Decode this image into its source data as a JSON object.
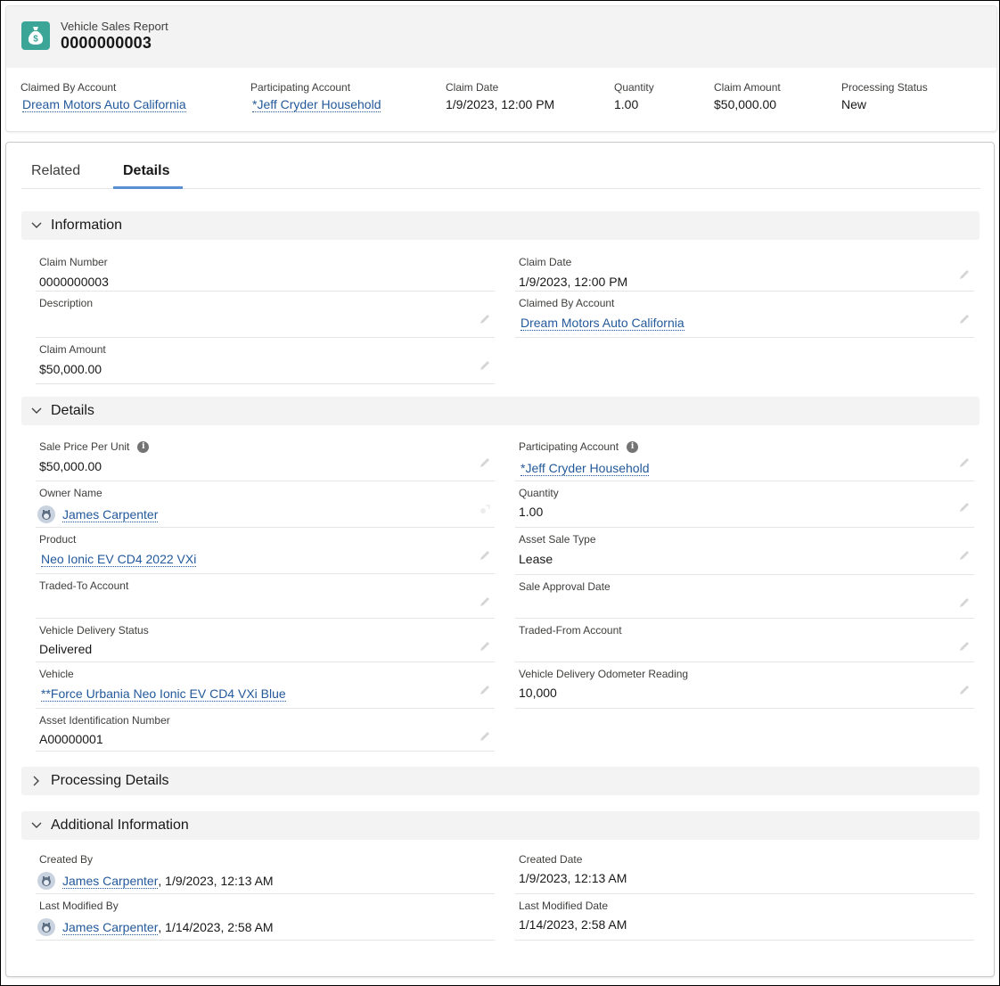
{
  "header": {
    "object_type": "Vehicle Sales Report",
    "record_title": "0000000003",
    "icon": "money-bag-icon",
    "icon_color": "#3ba597"
  },
  "highlights": [
    {
      "label": "Claimed By Account",
      "value": "Dream Motors Auto California",
      "link": true
    },
    {
      "label": "Participating Account",
      "value": "*Jeff Cryder Household",
      "link": true
    },
    {
      "label": "Claim Date",
      "value": "1/9/2023, 12:00 PM",
      "link": false
    },
    {
      "label": "Quantity",
      "value": "1.00",
      "link": false
    },
    {
      "label": "Claim Amount",
      "value": "$50,000.00",
      "link": false
    },
    {
      "label": "Processing Status",
      "value": "New",
      "link": false
    }
  ],
  "tabs": [
    {
      "label": "Related",
      "active": false
    },
    {
      "label": "Details",
      "active": true
    }
  ],
  "sections": {
    "information": {
      "title": "Information",
      "expanded": true,
      "left": [
        {
          "label": "Claim Number",
          "value": "0000000003",
          "editable": false
        },
        {
          "label": "Description",
          "value": "",
          "editable": true
        },
        {
          "label": "Claim Amount",
          "value": "$50,000.00",
          "editable": true
        }
      ],
      "right": [
        {
          "label": "Claim Date",
          "value": "1/9/2023, 12:00 PM",
          "editable": true
        },
        {
          "label": "Claimed By Account",
          "value": "Dream Motors Auto California",
          "link": true,
          "editable": true
        }
      ]
    },
    "details": {
      "title": "Details",
      "expanded": true,
      "left": [
        {
          "label": "Sale Price Per Unit",
          "value": "$50,000.00",
          "info": true,
          "editable": true
        },
        {
          "label": "Owner Name",
          "value": "James Carpenter",
          "link": true,
          "avatar": true,
          "action": "change-owner"
        },
        {
          "label": "Product",
          "value": "Neo Ionic EV CD4 2022 VXi",
          "link": true,
          "editable": true
        },
        {
          "label": "Traded-To Account",
          "value": "",
          "editable": true
        },
        {
          "label": "Vehicle Delivery Status",
          "value": "Delivered",
          "editable": true
        },
        {
          "label": "Vehicle",
          "value": "**Force Urbania Neo Ionic EV CD4 VXi Blue",
          "link": true,
          "editable": true
        },
        {
          "label": "Asset Identification Number",
          "value": "A00000001",
          "editable": true
        }
      ],
      "right": [
        {
          "label": "Participating Account",
          "value": "*Jeff Cryder Household",
          "link": true,
          "info": true,
          "editable": true
        },
        {
          "label": "Quantity",
          "value": "1.00",
          "editable": true
        },
        {
          "label": "Asset Sale Type",
          "value": "Lease",
          "editable": true
        },
        {
          "label": "Sale Approval Date",
          "value": "",
          "editable": true
        },
        {
          "label": "Traded-From Account",
          "value": "",
          "editable": true
        },
        {
          "label": "Vehicle Delivery Odometer Reading",
          "value": "10,000",
          "editable": true
        }
      ]
    },
    "processing": {
      "title": "Processing Details",
      "expanded": false
    },
    "additional": {
      "title": "Additional Information",
      "expanded": true,
      "left": [
        {
          "label": "Created By",
          "user": "James Carpenter",
          "suffix": ", 1/9/2023, 12:13 AM"
        },
        {
          "label": "Last Modified By",
          "user": "James Carpenter",
          "suffix": ", 1/14/2023, 2:58 AM"
        }
      ],
      "right": [
        {
          "label": "Created Date",
          "value": "1/9/2023, 12:13 AM"
        },
        {
          "label": "Last Modified Date",
          "value": "1/14/2023, 2:58 AM"
        }
      ]
    }
  }
}
